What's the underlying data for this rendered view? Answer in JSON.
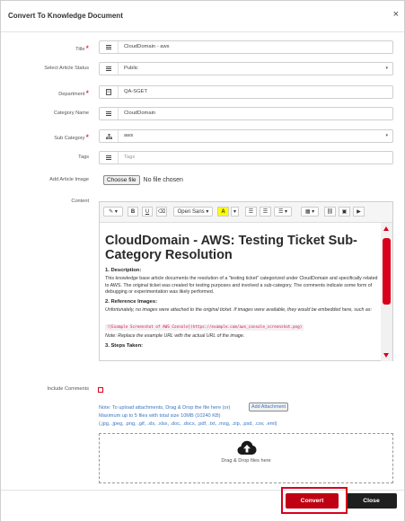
{
  "dialog": {
    "title": "Convert To Knowledge Document",
    "close_glyph": "×"
  },
  "form": {
    "title_label": "Title",
    "title_value": "CloudDomain - aws",
    "status_label": "Select Article Status",
    "status_value": "Public",
    "department_label": "Department",
    "department_value": "QA-SGET",
    "category_label": "Category Name",
    "category_value": "CloudDomain",
    "subcategory_label": "Sub Category",
    "subcategory_value": "aws",
    "tags_label": "Tags",
    "tags_placeholder": "Tags",
    "image_label": "Add Article Image",
    "choose_file_label": "Choose file",
    "no_file_text": "No file chosen",
    "content_label": "Content",
    "include_comments_label": "Include Comments",
    "required_mark": "*"
  },
  "toolbar": {
    "magic": "✎",
    "bold": "B",
    "underline": "U",
    "eraser": "⌫",
    "font_name": "Open Sans",
    "color_letter": "A",
    "ul": "☰",
    "ol": "☰",
    "align": "☰",
    "table": "▦",
    "link": "⛓",
    "image": "▣",
    "video": "▶"
  },
  "content": {
    "heading": "CloudDomain - AWS: Testing Ticket Sub-Category Resolution",
    "s1_title": "1. Description:",
    "s1_text": "This knowledge base article documents the resolution of a \"testing ticket\" categorized under CloudDomain and specifically related to AWS. The original ticket was created for testing purposes and involved a sub-category. The comments indicate some form of debugging or experimentation was likely performed.",
    "s2_title": "2. Reference Images:",
    "s2_text": "Unfortunately, no images were attached to the original ticket. If images were available, they would be embedded here, such as:",
    "code": "![Example Screenshot of AWS Console](https://example.com/aws_console_screenshot.png)",
    "note": "Note: Replace the example URL with the actual URL of the image.",
    "s3_title": "3. Steps Taken:"
  },
  "attachments": {
    "upload_text": "Note: To upload attachments, Drag & Drop the file here (or)",
    "add_button": "Add Attachment",
    "limit_text": "Maximum up to 5 files with total size 10MB (10240 KB)",
    "types_text": "(.jpg, .jpeg, .png, .gif, .xls, .xlsx, .doc, .docx, .pdf, .txt, .msg, .zip, .psd, .csv, .eml)",
    "dropzone_text": "Drag & Drop files here"
  },
  "footer": {
    "convert": "Convert",
    "close": "Close"
  },
  "colors": {
    "accent_red": "#c00013",
    "link_blue": "#3a76c4",
    "dark_button": "#1f1f1f"
  }
}
